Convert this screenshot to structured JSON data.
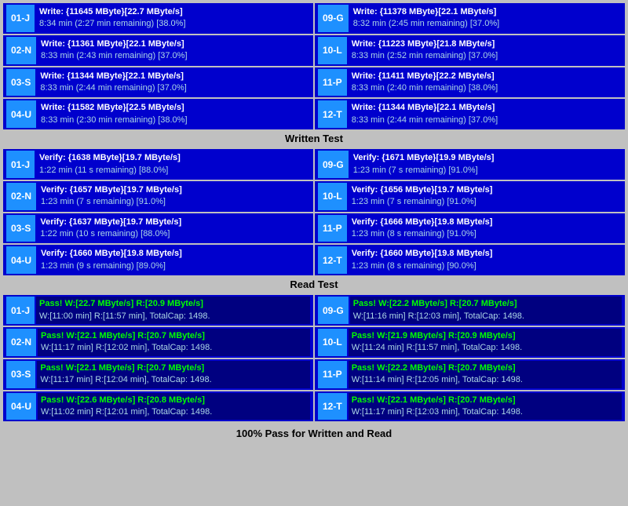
{
  "sections": {
    "written_test": {
      "label": "Written Test",
      "rows": [
        {
          "left": {
            "id": "01-J",
            "line1": "Write: {11645 MByte}[22.7 MByte/s]",
            "line2": "8:34 min (2:27 min remaining)  [38.0%]"
          },
          "right": {
            "id": "09-G",
            "line1": "Write: {11378 MByte}[22.1 MByte/s]",
            "line2": "8:32 min (2:45 min remaining)  [37.0%]"
          }
        },
        {
          "left": {
            "id": "02-N",
            "line1": "Write: {11361 MByte}[22.1 MByte/s]",
            "line2": "8:33 min (2:43 min remaining)  [37.0%]"
          },
          "right": {
            "id": "10-L",
            "line1": "Write: {11223 MByte}[21.8 MByte/s]",
            "line2": "8:33 min (2:52 min remaining)  [37.0%]"
          }
        },
        {
          "left": {
            "id": "03-S",
            "line1": "Write: {11344 MByte}[22.1 MByte/s]",
            "line2": "8:33 min (2:44 min remaining)  [37.0%]"
          },
          "right": {
            "id": "11-P",
            "line1": "Write: {11411 MByte}[22.2 MByte/s]",
            "line2": "8:33 min (2:40 min remaining)  [38.0%]"
          }
        },
        {
          "left": {
            "id": "04-U",
            "line1": "Write: {11582 MByte}[22.5 MByte/s]",
            "line2": "8:33 min (2:30 min remaining)  [38.0%]"
          },
          "right": {
            "id": "12-T",
            "line1": "Write: {11344 MByte}[22.1 MByte/s]",
            "line2": "8:33 min (2:44 min remaining)  [37.0%]"
          }
        }
      ]
    },
    "verify_test": {
      "rows": [
        {
          "left": {
            "id": "01-J",
            "line1": "Verify: {1638 MByte}[19.7 MByte/s]",
            "line2": "1:22 min (11 s remaining)  [88.0%]"
          },
          "right": {
            "id": "09-G",
            "line1": "Verify: {1671 MByte}[19.9 MByte/s]",
            "line2": "1:23 min (7 s remaining)  [91.0%]"
          }
        },
        {
          "left": {
            "id": "02-N",
            "line1": "Verify: {1657 MByte}[19.7 MByte/s]",
            "line2": "1:23 min (7 s remaining)  [91.0%]"
          },
          "right": {
            "id": "10-L",
            "line1": "Verify: {1656 MByte}[19.7 MByte/s]",
            "line2": "1:23 min (7 s remaining)  [91.0%]"
          }
        },
        {
          "left": {
            "id": "03-S",
            "line1": "Verify: {1637 MByte}[19.7 MByte/s]",
            "line2": "1:22 min (10 s remaining)  [88.0%]"
          },
          "right": {
            "id": "11-P",
            "line1": "Verify: {1666 MByte}[19.8 MByte/s]",
            "line2": "1:23 min (8 s remaining)  [91.0%]"
          }
        },
        {
          "left": {
            "id": "04-U",
            "line1": "Verify: {1660 MByte}[19.8 MByte/s]",
            "line2": "1:23 min (9 s remaining)  [89.0%]"
          },
          "right": {
            "id": "12-T",
            "line1": "Verify: {1660 MByte}[19.8 MByte/s]",
            "line2": "1:23 min (8 s remaining)  [90.0%]"
          }
        }
      ]
    },
    "read_test": {
      "label": "Read Test",
      "rows": [
        {
          "left": {
            "id": "01-J",
            "line1": "Pass! W:[22.7 MByte/s] R:[20.9 MByte/s]",
            "line2": "W:[11:00 min] R:[11:57 min], TotalCap: 1498."
          },
          "right": {
            "id": "09-G",
            "line1": "Pass! W:[22.2 MByte/s] R:[20.7 MByte/s]",
            "line2": "W:[11:16 min] R:[12:03 min], TotalCap: 1498."
          }
        },
        {
          "left": {
            "id": "02-N",
            "line1": "Pass! W:[22.1 MByte/s] R:[20.7 MByte/s]",
            "line2": "W:[11:17 min] R:[12:02 min], TotalCap: 1498."
          },
          "right": {
            "id": "10-L",
            "line1": "Pass! W:[21.9 MByte/s] R:[20.9 MByte/s]",
            "line2": "W:[11:24 min] R:[11:57 min], TotalCap: 1498."
          }
        },
        {
          "left": {
            "id": "03-S",
            "line1": "Pass! W:[22.1 MByte/s] R:[20.7 MByte/s]",
            "line2": "W:[11:17 min] R:[12:04 min], TotalCap: 1498."
          },
          "right": {
            "id": "11-P",
            "line1": "Pass! W:[22.2 MByte/s] R:[20.7 MByte/s]",
            "line2": "W:[11:14 min] R:[12:05 min], TotalCap: 1498."
          }
        },
        {
          "left": {
            "id": "04-U",
            "line1": "Pass! W:[22.6 MByte/s] R:[20.8 MByte/s]",
            "line2": "W:[11:02 min] R:[12:01 min], TotalCap: 1498."
          },
          "right": {
            "id": "12-T",
            "line1": "Pass! W:[22.1 MByte/s] R:[20.7 MByte/s]",
            "line2": "W:[11:17 min] R:[12:03 min], TotalCap: 1498."
          }
        }
      ]
    }
  },
  "status_bar": "100% Pass for Written and Read",
  "written_test_label": "Written Test",
  "read_test_label": "Read Test"
}
